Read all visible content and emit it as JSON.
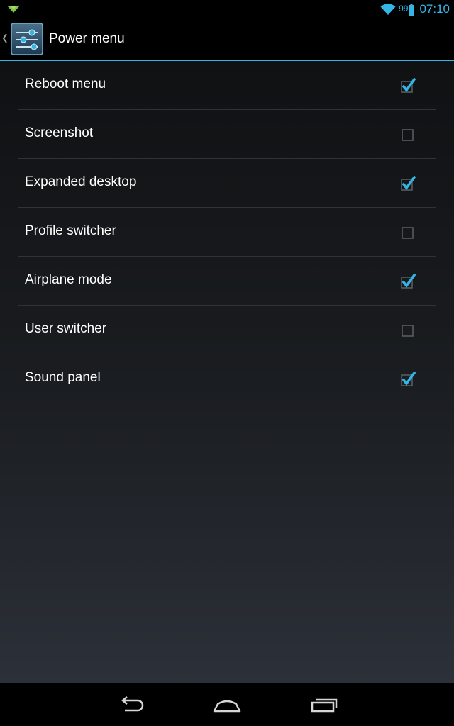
{
  "status_bar": {
    "battery_level": "99",
    "time": "07:10",
    "notification_icon": "play-store-download-icon",
    "wifi_icon": "wifi-icon",
    "battery_icon": "battery-icon"
  },
  "action_bar": {
    "title": "Power menu",
    "app_icon": "settings-sliders-icon",
    "up_icon": "chevron-left-icon"
  },
  "preferences": [
    {
      "label": "Reboot menu",
      "checked": true
    },
    {
      "label": "Screenshot",
      "checked": false
    },
    {
      "label": "Expanded desktop",
      "checked": true
    },
    {
      "label": "Profile switcher",
      "checked": false
    },
    {
      "label": "Airplane mode",
      "checked": true
    },
    {
      "label": "User switcher",
      "checked": false
    },
    {
      "label": "Sound panel",
      "checked": true
    }
  ],
  "nav_bar": {
    "back_icon": "back-icon",
    "home_icon": "home-icon",
    "recents_icon": "recents-icon"
  },
  "colors": {
    "accent": "#33b5e5",
    "text": "#ffffff",
    "divider": "#2f3237",
    "checkbox_border": "#5c6066"
  }
}
